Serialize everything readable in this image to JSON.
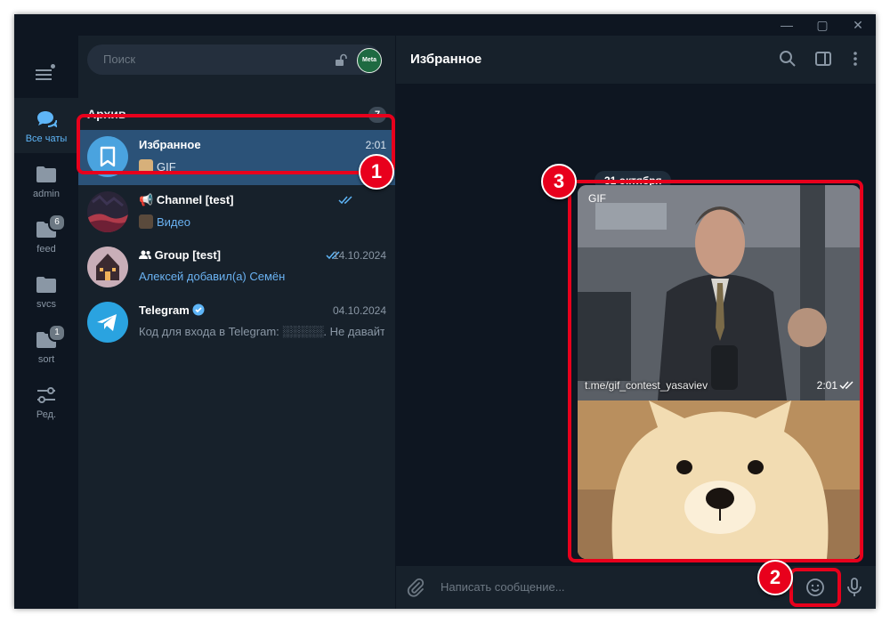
{
  "sidebar": {
    "folders": [
      {
        "label": "Все чаты",
        "icon": "chats-icon",
        "badge": ""
      },
      {
        "label": "admin",
        "icon": "folder-icon",
        "badge": ""
      },
      {
        "label": "feed",
        "icon": "folder-icon",
        "badge": "6"
      },
      {
        "label": "svcs",
        "icon": "folder-icon",
        "badge": ""
      },
      {
        "label": "sort",
        "icon": "folder-icon",
        "badge": "1"
      },
      {
        "label": "Ред.",
        "icon": "sliders-icon",
        "badge": ""
      }
    ]
  },
  "search": {
    "placeholder": "Поиск"
  },
  "account": {
    "avatar_text": "Meta"
  },
  "archive": {
    "label": "Архив",
    "count": "7"
  },
  "chats": [
    {
      "name": "Избранное",
      "time": "2:01",
      "preview": "GIF"
    },
    {
      "name": "Channel [test]",
      "time": "",
      "preview": "Видео"
    },
    {
      "name": "Group [test]",
      "time": "14.10.2024",
      "preview": "Алексей добавил(а) Семён"
    },
    {
      "name": "Telegram",
      "time": "04.10.2024",
      "preview": "Код для входа в Telegram: ░░░░░. Не давайте"
    }
  ],
  "chat": {
    "title": "Избранное",
    "date_chip": "31 октября",
    "gif_label": "GIF",
    "gif_via": "t.me/gif_contest_yasaviev",
    "gif_time": "2:01",
    "composer_placeholder": "Написать сообщение..."
  },
  "annotations": [
    "1",
    "2",
    "3"
  ],
  "colors": {
    "accent": "#5eb5f7",
    "highlight": "#e8001c",
    "selected": "#2b5278"
  }
}
